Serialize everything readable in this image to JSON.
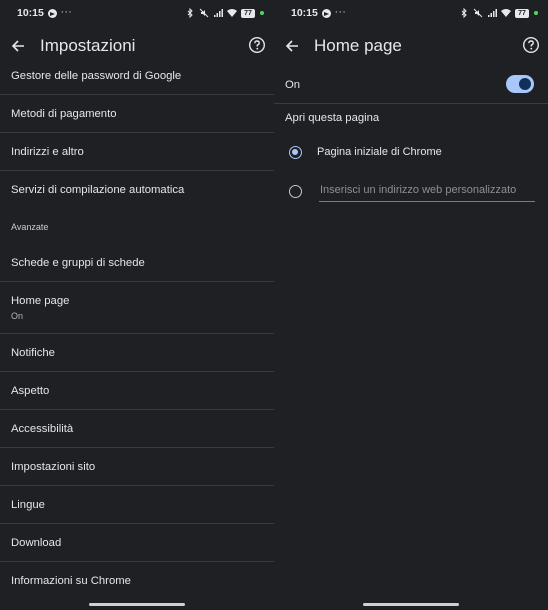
{
  "status_bar": {
    "time": "10:15",
    "overflow": "···",
    "battery": "77",
    "icons": [
      "telegram-icon",
      "bluetooth-icon",
      "mute-icon",
      "signal-icon",
      "wifi-icon",
      "battery-icon"
    ]
  },
  "left": {
    "title": "Impostazioni",
    "items": [
      {
        "label": "Gestore delle password di Google"
      },
      {
        "label": "Metodi di pagamento"
      },
      {
        "label": "Indirizzi e altro"
      },
      {
        "label": "Servizi di compilazione automatica"
      }
    ],
    "section_label": "Avanzate",
    "advanced_items": [
      {
        "label": "Schede e gruppi di schede"
      },
      {
        "label": "Home page",
        "sub": "On"
      },
      {
        "label": "Notifiche"
      },
      {
        "label": "Aspetto"
      },
      {
        "label": "Accessibilità"
      },
      {
        "label": "Impostazioni sito"
      },
      {
        "label": "Lingue"
      },
      {
        "label": "Download"
      },
      {
        "label": "Informazioni su Chrome"
      }
    ]
  },
  "right": {
    "title": "Home page",
    "toggle_label": "On",
    "toggle_on": true,
    "section_label": "Apri questa pagina",
    "option_chrome": "Pagina iniziale di Chrome",
    "option_custom_placeholder": "Inserisci un indirizzo web personalizzato",
    "selected_option": "chrome"
  },
  "colors": {
    "background": "#1f2024",
    "divider": "#3a3b40",
    "accent": "#a8c7fa",
    "text": "#e6e6ea"
  }
}
